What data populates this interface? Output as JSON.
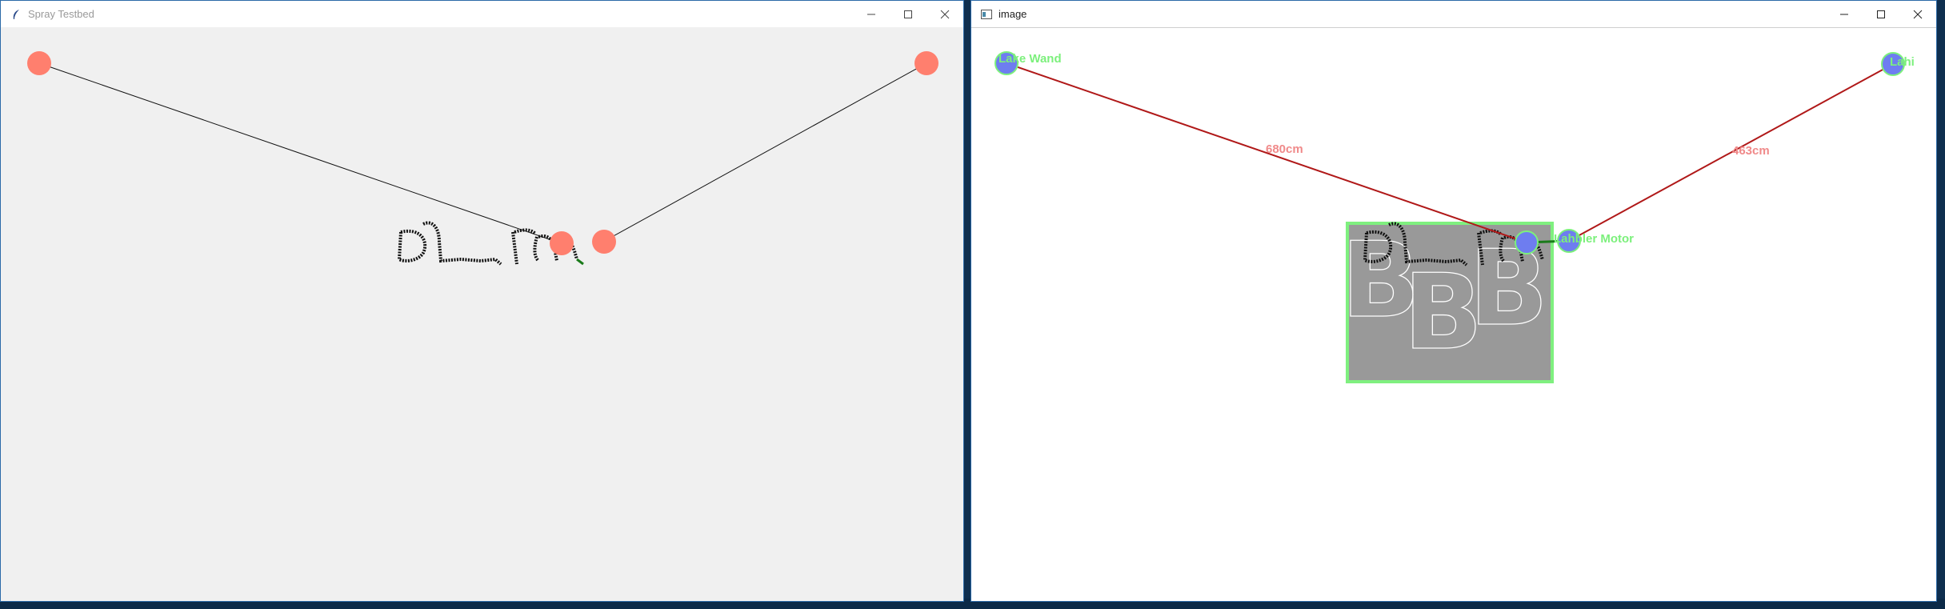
{
  "left_window": {
    "title": "Spray Testbed",
    "icon": "feather-icon"
  },
  "right_window": {
    "title": "image",
    "icon": "window-app-icon",
    "labels": {
      "node_left": "Lake Wand",
      "node_right": "Lahi",
      "node_motor": "Lahbler Motor",
      "dist_left": "680cm",
      "dist_right": "463cm"
    },
    "roi_letters": [
      "B",
      "B",
      "B"
    ]
  },
  "colors": {
    "node_fill": "#ff7f6e",
    "label_green": "#7cf07c",
    "measure_red": "#f08a8a",
    "line_dark_red": "#b01818",
    "roi_fill": "#999999",
    "roi_border": "#7ff07f",
    "node_blue": "#6e7df0"
  }
}
